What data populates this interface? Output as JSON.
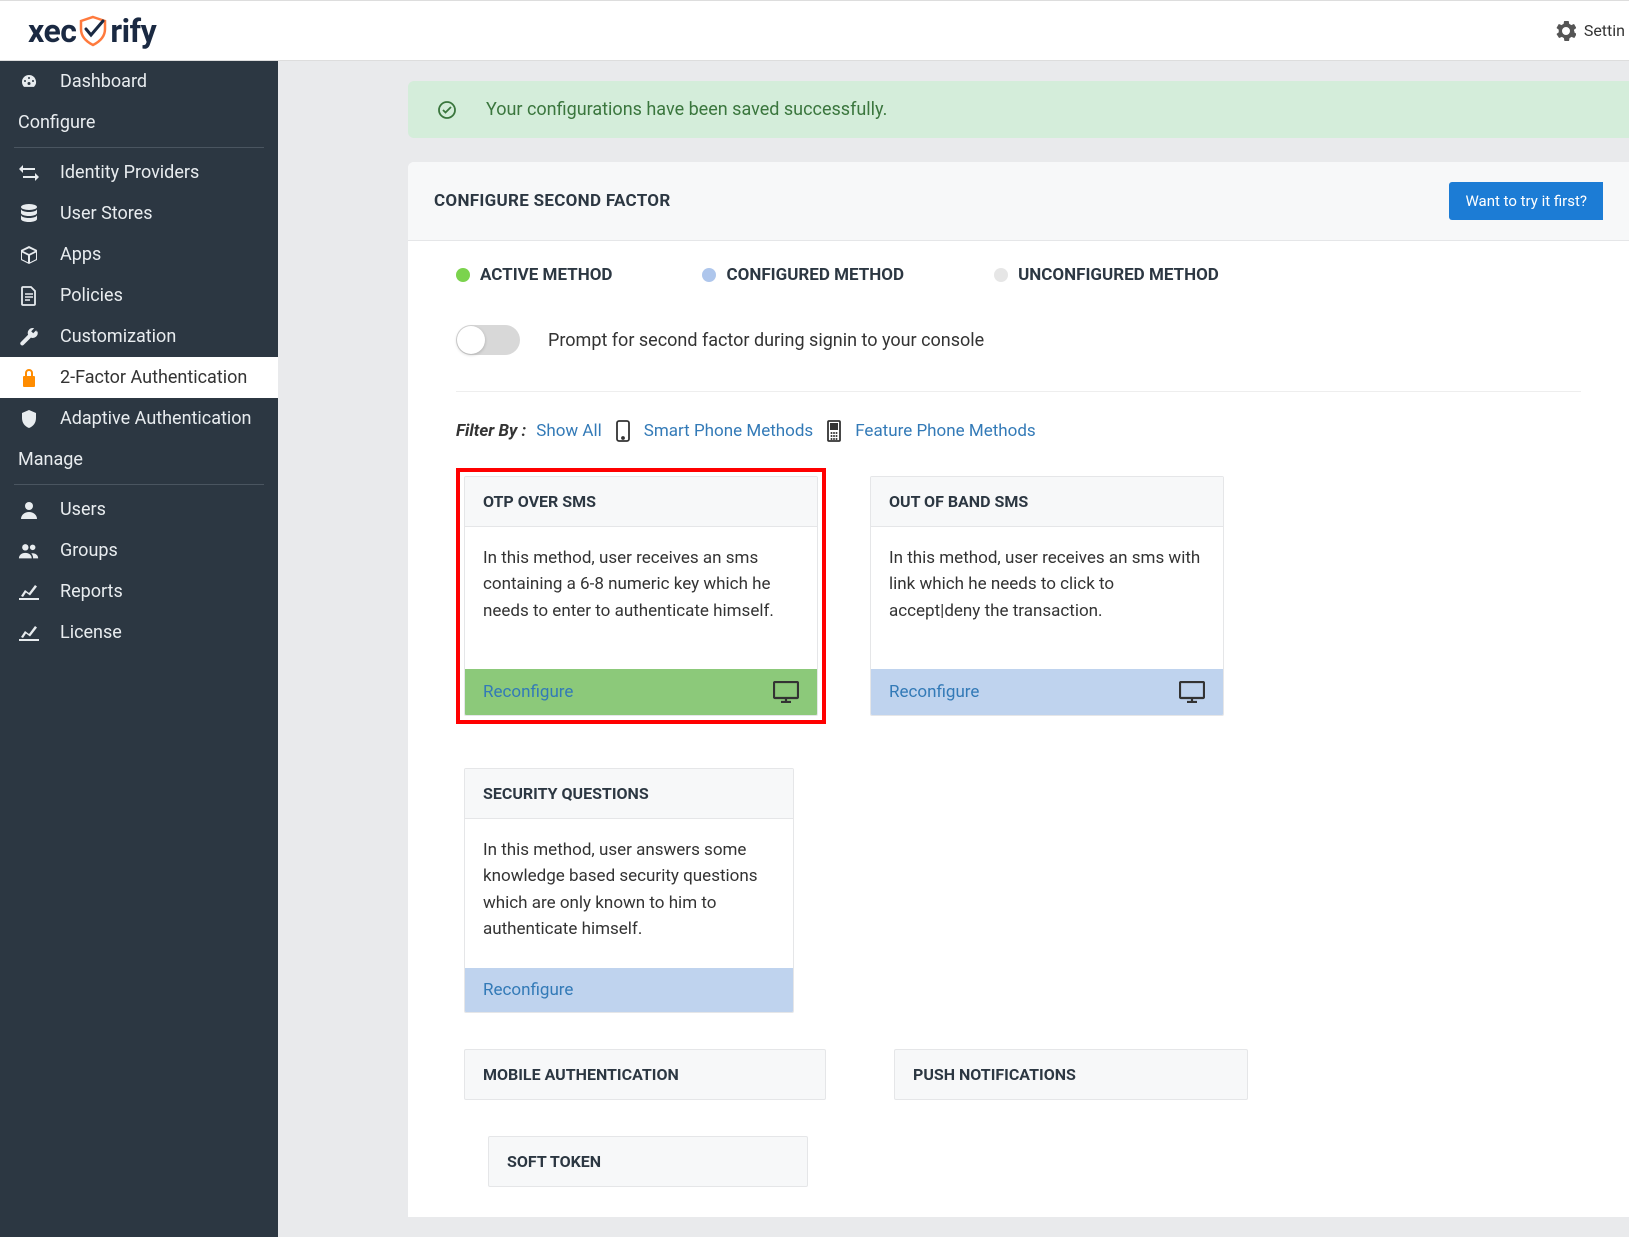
{
  "header": {
    "logo_text_1": "xec",
    "logo_text_2": "rify",
    "settings_label": "Settin"
  },
  "sidebar": {
    "items": [
      {
        "icon": "dashboard",
        "label": "Dashboard"
      },
      {
        "section": true,
        "label": "Configure"
      },
      {
        "icon": "exchange",
        "label": "Identity Providers"
      },
      {
        "icon": "database",
        "label": "User Stores"
      },
      {
        "icon": "cube",
        "label": "Apps"
      },
      {
        "icon": "file",
        "label": "Policies"
      },
      {
        "icon": "wrench",
        "label": "Customization"
      },
      {
        "icon": "lock",
        "label": "2-Factor Authentication",
        "active": true
      },
      {
        "icon": "shield",
        "label": "Adaptive Authentication"
      },
      {
        "section": true,
        "label": "Manage"
      },
      {
        "icon": "user",
        "label": "Users"
      },
      {
        "icon": "users",
        "label": "Groups"
      },
      {
        "icon": "chart",
        "label": "Reports"
      },
      {
        "icon": "chart",
        "label": "License"
      }
    ]
  },
  "alert": {
    "message": "Your configurations have been saved successfully."
  },
  "panel": {
    "title": "CONFIGURE SECOND FACTOR",
    "try_button": "Want to try it first?"
  },
  "legend": {
    "active": "ACTIVE METHOD",
    "configured": "CONFIGURED METHOD",
    "unconfigured": "UNCONFIGURED METHOD"
  },
  "toggle": {
    "label": "Prompt for second factor during signin to your console"
  },
  "filter": {
    "label": "Filter By :",
    "show_all": "Show All",
    "smart_phone": "Smart Phone Methods",
    "feature_phone": "Feature Phone Methods"
  },
  "cards": {
    "row1": [
      {
        "title": "OTP OVER SMS",
        "body": "In this method, user receives an sms containing a 6-8 numeric key which he needs to enter to authenticate himself.",
        "footer": "Reconfigure",
        "status": "active",
        "highlighted": true
      },
      {
        "title": "OUT OF BAND SMS",
        "body": "In this method, user receives an sms with link which he needs to click to accept|deny the transaction.",
        "footer": "Reconfigure",
        "status": "configured"
      },
      {
        "title": "SECURITY QUESTIONS",
        "body": "In this method, user answers some knowledge based security questions which are only known to him to authenticate himself.",
        "footer": "Reconfigure",
        "status": "configured",
        "partial": true
      }
    ],
    "row2": [
      {
        "title": "MOBILE AUTHENTICATION"
      },
      {
        "title": "PUSH NOTIFICATIONS"
      },
      {
        "title": "SOFT TOKEN"
      }
    ]
  }
}
